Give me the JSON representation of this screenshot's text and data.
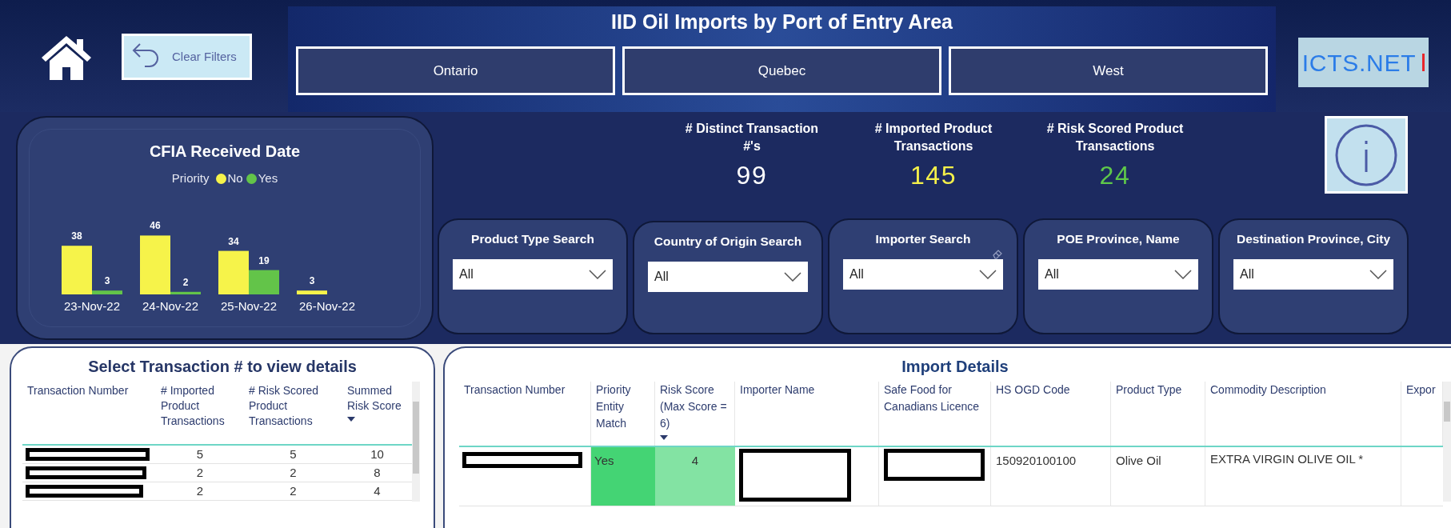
{
  "header": {
    "title": "IID Oil Imports by Port of Entry Area",
    "clear_filters": "Clear Filters",
    "logo": "ICTS.NET",
    "regions": [
      {
        "label": "Ontario",
        "selected": false
      },
      {
        "label": "Quebec",
        "selected": false
      },
      {
        "label": "West",
        "selected": false
      }
    ]
  },
  "date_chart": {
    "title": "CFIA Received Date",
    "legend_title": "Priority",
    "chart_data": {
      "type": "bar",
      "categories": [
        "23-Nov-22",
        "24-Nov-22",
        "25-Nov-22",
        "26-Nov-22"
      ],
      "data_labels": true,
      "series": [
        {
          "name": "No",
          "color": "#f6f34a",
          "values": [
            38,
            46,
            34,
            3
          ]
        },
        {
          "name": "Yes",
          "color": "#63c449",
          "values": [
            3,
            2,
            19,
            null
          ]
        }
      ]
    }
  },
  "kpis": [
    {
      "label": "# Distinct Transaction #'s",
      "value": "99",
      "color": "#ffffff"
    },
    {
      "label": "# Imported Product Transactions",
      "value": "145",
      "color": "#f4f04a"
    },
    {
      "label": "# Risk Scored Product Transactions",
      "value": "24",
      "color": "#5fc84a"
    }
  ],
  "slicers": [
    {
      "label": "Product Type Search",
      "value": "All",
      "eraser": false
    },
    {
      "label": "Country of Origin Search",
      "value": "All",
      "eraser": false
    },
    {
      "label": "Importer Search",
      "value": "All",
      "eraser": true
    },
    {
      "label": "POE Province, Name",
      "value": "All",
      "eraser": false
    },
    {
      "label": "Destination Province, City",
      "value": "All",
      "eraser": false
    }
  ],
  "transactions": {
    "title": "Select Transaction # to view details",
    "columns": [
      {
        "label": "Transaction Number",
        "sorted": false
      },
      {
        "label": "# Imported Product Transactions",
        "sorted": false
      },
      {
        "label": "# Risk Scored Product Transactions",
        "sorted": false
      },
      {
        "label": "Summed Risk Score",
        "sorted": true
      }
    ],
    "rows": [
      {
        "imported": "5",
        "risk_scored": "5",
        "summed": "10"
      },
      {
        "imported": "2",
        "risk_scored": "2",
        "summed": "8"
      },
      {
        "imported": "2",
        "risk_scored": "2",
        "summed": "4"
      }
    ]
  },
  "import_details": {
    "title": "Import Details",
    "columns": [
      {
        "label": "Transaction Number",
        "sorted": false
      },
      {
        "label": "Priority Entity Match",
        "sorted": false
      },
      {
        "label": "Risk Score (Max Score = 6)",
        "sorted": true
      },
      {
        "label": "Importer Name",
        "sorted": false
      },
      {
        "label": "Safe Food for Canadians Licence",
        "sorted": false
      },
      {
        "label": "HS OGD Code",
        "sorted": false
      },
      {
        "label": "Product Type",
        "sorted": false
      },
      {
        "label": "Commodity Description",
        "sorted": false
      },
      {
        "label": "Expor",
        "sorted": false
      }
    ],
    "rows": [
      {
        "priority_match": "Yes",
        "risk_score": "4",
        "hs_code": "150920100100",
        "product_type": "Olive Oil",
        "commodity": "EXTRA VIRGIN OLIVE OIL *"
      }
    ]
  }
}
